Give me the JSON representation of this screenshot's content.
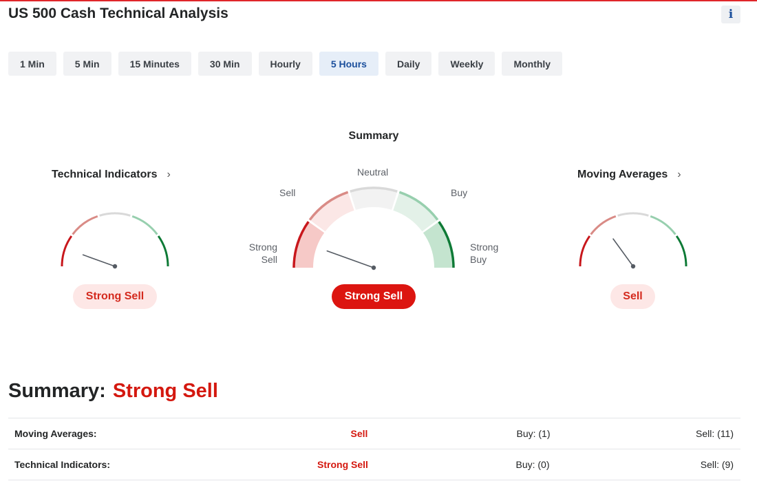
{
  "header": {
    "title": "US 500 Cash Technical Analysis",
    "info_label": "i"
  },
  "tabs": [
    {
      "label": "1 Min",
      "active": false
    },
    {
      "label": "5 Min",
      "active": false
    },
    {
      "label": "15 Minutes",
      "active": false
    },
    {
      "label": "30 Min",
      "active": false
    },
    {
      "label": "Hourly",
      "active": false
    },
    {
      "label": "5 Hours",
      "active": true
    },
    {
      "label": "Daily",
      "active": false
    },
    {
      "label": "Weekly",
      "active": false
    },
    {
      "label": "Monthly",
      "active": false
    }
  ],
  "summary_gauge": {
    "title": "Summary",
    "labels": {
      "neutral": "Neutral",
      "sell": "Sell",
      "buy": "Buy",
      "strong_sell_1": "Strong",
      "strong_sell_2": "Sell",
      "strong_buy_1": "Strong",
      "strong_buy_2": "Buy"
    },
    "verdict": "Strong Sell",
    "needle_value": 0.11
  },
  "technical_gauge": {
    "title": "Technical Indicators",
    "chevron": "›",
    "verdict": "Strong Sell",
    "needle_value": 0.11
  },
  "ma_gauge": {
    "title": "Moving Averages",
    "chevron": "›",
    "verdict": "Sell",
    "needle_value": 0.3
  },
  "colors": {
    "strong_sell": "#c8171c",
    "sell": "#d98b86",
    "neutral": "#d9d9d9",
    "buy": "#97cfae",
    "strong_buy": "#0e7a36"
  },
  "summary": {
    "label": "Summary:",
    "verdict": "Strong Sell",
    "rows": [
      {
        "label": "Moving Averages:",
        "verdict": "Sell",
        "buy": "Buy: (1)",
        "sell": "Sell: (11)"
      },
      {
        "label": "Technical Indicators:",
        "verdict": "Strong Sell",
        "buy": "Buy: (0)",
        "sell": "Sell: (9)"
      }
    ]
  }
}
